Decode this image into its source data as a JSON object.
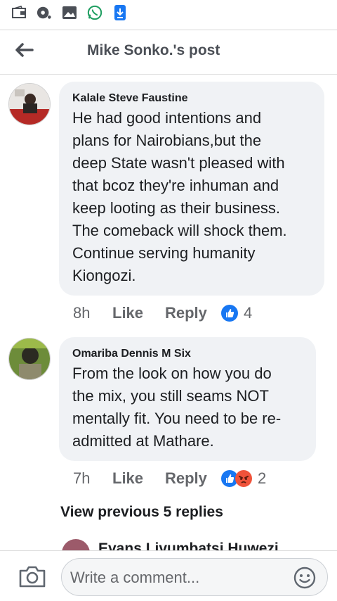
{
  "header": {
    "title": "Mike Sonko.'s post"
  },
  "comments": [
    {
      "author": "Kalale Steve Faustine",
      "lines": [
        "He had good intentions and",
        "plans for Nairobians,but the",
        "deep State wasn't pleased with",
        "that bcoz they're inhuman and",
        "keep looting as their business.",
        "The comeback will shock them.",
        "Continue serving humanity",
        "Kiongozi."
      ],
      "time": "8h",
      "like_label": "Like",
      "reply_label": "Reply",
      "reactions": [
        "like"
      ],
      "reaction_count": "4"
    },
    {
      "author": "Omariba Dennis M Six",
      "lines": [
        "From the look on how you do",
        "the mix, you still  seams NOT",
        "mentally fit. You need to be re-",
        "admitted at Mathare."
      ],
      "time": "7h",
      "like_label": "Like",
      "reply_label": "Reply",
      "reactions": [
        "like",
        "angry"
      ],
      "reaction_count": "2"
    }
  ],
  "view_previous": "View previous 5 replies",
  "partial_comment": {
    "text": "Evans Livumbatsi  Huwezi"
  },
  "composer": {
    "placeholder": "Write a comment..."
  },
  "colors": {
    "like_blue": "#1877f2",
    "angry_orange": "#f0533a",
    "bubble": "#f0f2f5",
    "muted": "#65676b"
  },
  "icons": [
    "wallet-icon",
    "chat-dot-icon",
    "gallery-icon",
    "whatsapp-icon",
    "download-icon",
    "back-arrow-icon",
    "camera-icon",
    "emoji-icon"
  ]
}
